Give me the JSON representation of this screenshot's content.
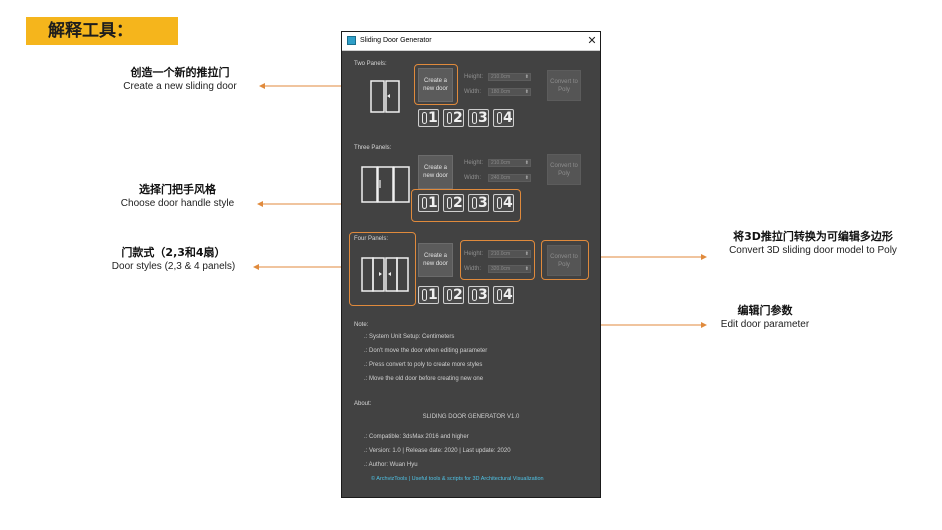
{
  "page_title": "解释工具：",
  "annotations": {
    "create": {
      "zh": "创造一个新的推拉门",
      "en": "Create a new sliding door"
    },
    "handle": {
      "zh": "选择门把手风格",
      "en": "Choose door handle style"
    },
    "styles": {
      "zh": "门款式（2,3和4扇）",
      "en": "Door styles (2,3 & 4 panels)"
    },
    "convert": {
      "zh": "将3D推拉门转换为可编辑多边形",
      "en": "Convert 3D sliding door model to Poly"
    },
    "edit": {
      "zh": "编辑门参数",
      "en": "Edit door parameter"
    }
  },
  "window": {
    "title": "Sliding Door Generator",
    "close": "✕",
    "sections": [
      {
        "label": "Two Panels:",
        "create": "Create a new door",
        "convert": "Convert to Poly",
        "height_label": "Height:",
        "height_value": "210.0cm",
        "width_label": "Width:",
        "width_value": "180.0cm"
      },
      {
        "label": "Three Panels:",
        "create": "Create a new door",
        "convert": "Convert to Poly",
        "height_label": "Height:",
        "height_value": "210.0cm",
        "width_label": "Width:",
        "width_value": "240.0cm"
      },
      {
        "label": "Four Panels:",
        "create": "Create a new door",
        "convert": "Convert to Poly",
        "height_label": "Height:",
        "height_value": "210.0cm",
        "width_label": "Width:",
        "width_value": "320.0cm"
      }
    ],
    "handles": [
      "1",
      "2",
      "3",
      "4"
    ],
    "note": {
      "label": "Note:",
      "lines": [
        ".: System Unit Setup: Centimeters",
        ".: Don't move the door when editing parameter",
        ".: Press convert to poly to create more styles",
        ".: Move the old door before creating new one"
      ]
    },
    "about": {
      "label": "About:",
      "product": "SLIDING DOOR GENERATOR V1.0",
      "lines": [
        ".: Compatible: 3dsMax 2016 and higher",
        ".: Version: 1.0 | Release date: 2020 | Last update: 2020",
        ".: Author: Wuan Hyu"
      ],
      "link": "© ArchvizTools | Useful tools & scripts for 3D Architectural Visualization"
    }
  },
  "colors": {
    "accent": "#f5b51c",
    "highlight": "#e08a3c",
    "window_bg": "#424242",
    "link": "#4fc3e6"
  }
}
